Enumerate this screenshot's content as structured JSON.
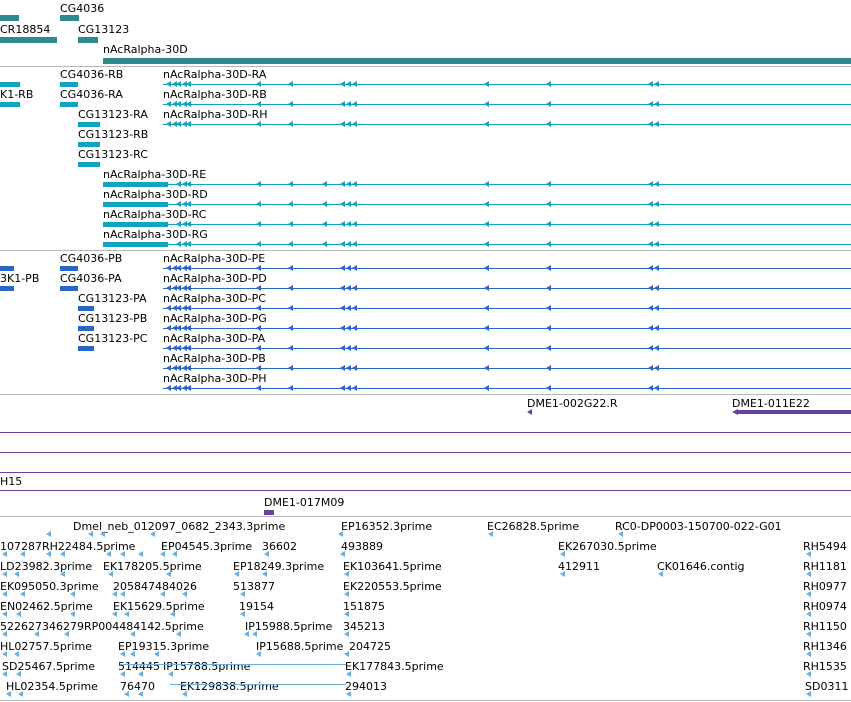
{
  "colors": {
    "gene": "#2e8b8b",
    "transcript": "#13a3c2",
    "protein": "#2a66c8",
    "clone": "#6b3fa0",
    "est": "#6ab0dc",
    "separator": "#b8b8b8"
  },
  "genes": {
    "labels": [
      "CG4036",
      "CR18854",
      "CG13123",
      "nAcRalpha-30D"
    ]
  },
  "transcripts": {
    "labels": [
      "CG4036-RB",
      "nAcRalpha-30D-RA",
      "K1-RB",
      "CG4036-RA",
      "nAcRalpha-30D-RB",
      "CG13123-RA",
      "nAcRalpha-30D-RH",
      "CG13123-RB",
      "CG13123-RC",
      "nAcRalpha-30D-RE",
      "nAcRalpha-30D-RD",
      "nAcRalpha-30D-RC",
      "nAcRalpha-30D-RG"
    ]
  },
  "proteins": {
    "labels": [
      "CG4036-PB",
      "nAcRalpha-30D-PE",
      "3K1-PB",
      "CG4036-PA",
      "nAcRalpha-30D-PD",
      "CG13123-PA",
      "nAcRalpha-30D-PC",
      "CG13123-PB",
      "nAcRalpha-30D-PG",
      "CG13123-PC",
      "nAcRalpha-30D-PA",
      "nAcRalpha-30D-PB",
      "nAcRalpha-30D-PH"
    ]
  },
  "clones": {
    "labels": [
      "DME1-002G22.R",
      "DME1-011E22",
      "H15",
      "DME1-017M09"
    ]
  },
  "ests": {
    "labels": [
      "Dmel_neb_012097_0682_2343.3prime",
      "EP16352.3prime",
      "EC26828.5prime",
      "RC0-DP0003-150700-022-G01",
      "107287RH22484.5prime",
      "EP04545.3prime",
      "36602",
      "493889",
      "EK267030.5prime",
      "RH5494",
      "LD23982.3prime",
      "EK178205.5prime",
      "EP18249.3prime",
      "EK103641.5prime",
      "412911",
      "CK01646.contig",
      "RH1181",
      "EK095050.3prime",
      "205847484026",
      "513877",
      "EK220553.5prime",
      "RH0977",
      "EN02462.5prime",
      "EK15629.5prime",
      "19154",
      "151875",
      "RH0974",
      "522627346279RP004484142.5prime",
      "IP15988.5prime",
      "345213",
      "RH1150",
      "HL02757.5prime",
      "EP19315.3prime",
      "IP15688.5prime",
      "204725",
      "RH1346",
      "SD25467.5prime",
      "514445",
      "IP15788.5prime",
      "EK177843.5prime",
      "RH1535",
      "HL02354.5prime",
      "76470",
      "EK129838.5prime",
      "294013",
      "SD0311"
    ]
  }
}
